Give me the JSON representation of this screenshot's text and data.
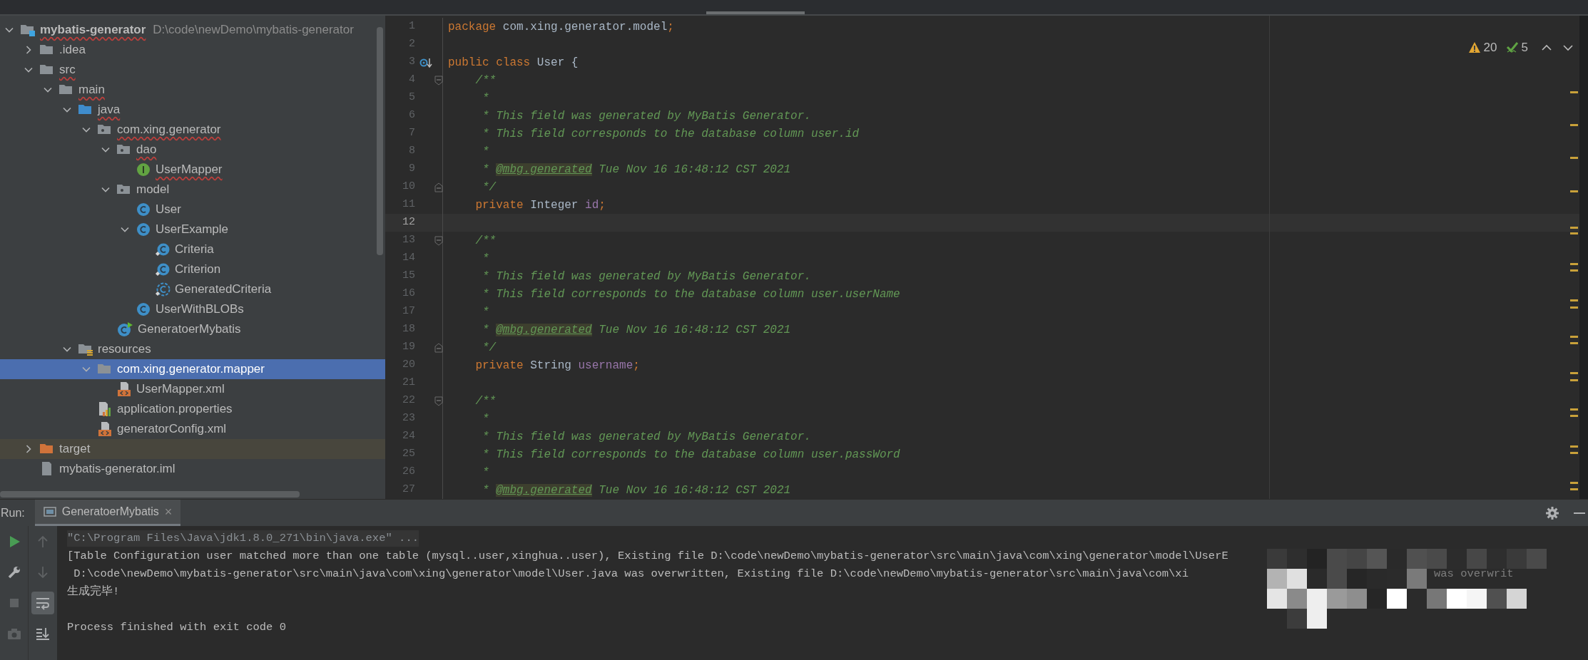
{
  "project_tree": {
    "items": [
      {
        "kind": "module",
        "label": "mybatis-generator",
        "path": "D:\\code\\newDemo\\mybatis-generator",
        "expanded": true,
        "selected": false,
        "error": true,
        "children": [
          {
            "kind": "folder",
            "label": ".idea",
            "expanded": false,
            "selected": false,
            "error": false
          },
          {
            "kind": "folder",
            "label": "src",
            "expanded": true,
            "selected": false,
            "error": true,
            "children": [
              {
                "kind": "folder",
                "label": "main",
                "expanded": true,
                "selected": false,
                "error": true,
                "children": [
                  {
                    "kind": "source-folder",
                    "label": "java",
                    "expanded": true,
                    "selected": false,
                    "error": true,
                    "children": [
                      {
                        "kind": "package",
                        "label": "com.xing.generator",
                        "expanded": true,
                        "selected": false,
                        "error": true,
                        "children": [
                          {
                            "kind": "package",
                            "label": "dao",
                            "expanded": true,
                            "selected": false,
                            "error": true,
                            "children": [
                              {
                                "kind": "interface",
                                "label": "UserMapper",
                                "selected": false,
                                "error": true
                              }
                            ]
                          },
                          {
                            "kind": "package",
                            "label": "model",
                            "expanded": true,
                            "selected": false,
                            "error": false,
                            "children": [
                              {
                                "kind": "class",
                                "label": "User",
                                "selected": false,
                                "error": false
                              },
                              {
                                "kind": "class",
                                "label": "UserExample",
                                "expanded": true,
                                "selected": false,
                                "error": false,
                                "children": [
                                  {
                                    "kind": "inner-class",
                                    "label": "Criteria",
                                    "selected": false,
                                    "error": false
                                  },
                                  {
                                    "kind": "inner-class",
                                    "label": "Criterion",
                                    "selected": false,
                                    "error": false
                                  },
                                  {
                                    "kind": "abstract-inner-class",
                                    "label": "GeneratedCriteria",
                                    "selected": false,
                                    "error": false
                                  }
                                ]
                              },
                              {
                                "kind": "class",
                                "label": "UserWithBLOBs",
                                "selected": false,
                                "error": false
                              }
                            ]
                          },
                          {
                            "kind": "runnable-class",
                            "label": "GeneratoerMybatis",
                            "selected": false,
                            "error": false
                          }
                        ]
                      }
                    ]
                  },
                  {
                    "kind": "resources-folder",
                    "label": "resources",
                    "expanded": true,
                    "selected": false,
                    "error": false,
                    "children": [
                      {
                        "kind": "folder",
                        "label": "com.xing.generator.mapper",
                        "expanded": true,
                        "selected": true,
                        "error": false,
                        "children": [
                          {
                            "kind": "xml",
                            "label": "UserMapper.xml",
                            "selected": false,
                            "error": false
                          }
                        ]
                      },
                      {
                        "kind": "properties",
                        "label": "application.properties",
                        "selected": false,
                        "error": false
                      },
                      {
                        "kind": "xml",
                        "label": "generatorConfig.xml",
                        "selected": false,
                        "error": false
                      }
                    ]
                  }
                ]
              }
            ]
          },
          {
            "kind": "excluded-folder",
            "label": "target",
            "expanded": false,
            "selected": false,
            "error": false,
            "highlighted": true
          },
          {
            "kind": "iml",
            "label": "mybatis-generator.iml",
            "selected": false,
            "error": false
          }
        ]
      }
    ]
  },
  "editor": {
    "problems": {
      "warnings": "20",
      "weak_warnings": "5"
    },
    "lines": [
      {
        "number": "1",
        "tokens": [
          {
            "kind": "keyword",
            "text": "package"
          },
          {
            "kind": "plain",
            "text": " com.xing.generator.model"
          },
          {
            "kind": "keyword",
            "text": ";"
          }
        ]
      },
      {
        "number": "2"
      },
      {
        "number": "3",
        "implemented_marker": true,
        "tokens": [
          {
            "kind": "keyword",
            "text": "public class"
          },
          {
            "kind": "plain",
            "text": " User {"
          }
        ]
      },
      {
        "number": "4",
        "fold_start": true,
        "tokens": [
          {
            "kind": "comment",
            "text": "    /**"
          }
        ]
      },
      {
        "number": "5",
        "tokens": [
          {
            "kind": "comment",
            "text": "     *"
          }
        ]
      },
      {
        "number": "6",
        "tokens": [
          {
            "kind": "comment",
            "text": "     * This field was generated by MyBatis Generator."
          }
        ]
      },
      {
        "number": "7",
        "tokens": [
          {
            "kind": "comment",
            "text": "     * This field corresponds to the database column user.id"
          }
        ]
      },
      {
        "number": "8",
        "tokens": [
          {
            "kind": "comment",
            "text": "     *"
          }
        ]
      },
      {
        "number": "9",
        "tokens": [
          {
            "kind": "comment",
            "text": "     * "
          },
          {
            "kind": "tag",
            "text": "@mbg.generated"
          },
          {
            "kind": "comment",
            "text": " Tue Nov 16 16:48:12 CST 2021"
          }
        ]
      },
      {
        "number": "10",
        "fold_end": true,
        "tokens": [
          {
            "kind": "comment",
            "text": "     */"
          }
        ]
      },
      {
        "number": "11",
        "tokens": [
          {
            "kind": "keyword",
            "text": "    private"
          },
          {
            "kind": "plain",
            "text": " Integer "
          },
          {
            "kind": "field",
            "text": "id"
          },
          {
            "kind": "keyword",
            "text": ";"
          }
        ]
      },
      {
        "number": "12",
        "current": true
      },
      {
        "number": "13",
        "fold_start": true,
        "tokens": [
          {
            "kind": "comment",
            "text": "    /**"
          }
        ]
      },
      {
        "number": "14",
        "tokens": [
          {
            "kind": "comment",
            "text": "     *"
          }
        ]
      },
      {
        "number": "15",
        "tokens": [
          {
            "kind": "comment",
            "text": "     * This field was generated by MyBatis Generator."
          }
        ]
      },
      {
        "number": "16",
        "tokens": [
          {
            "kind": "comment",
            "text": "     * This field corresponds to the database column user.userName"
          }
        ]
      },
      {
        "number": "17",
        "tokens": [
          {
            "kind": "comment",
            "text": "     *"
          }
        ]
      },
      {
        "number": "18",
        "tokens": [
          {
            "kind": "comment",
            "text": "     * "
          },
          {
            "kind": "tag",
            "text": "@mbg.generated"
          },
          {
            "kind": "comment",
            "text": " Tue Nov 16 16:48:12 CST 2021"
          }
        ]
      },
      {
        "number": "19",
        "fold_end": true,
        "tokens": [
          {
            "kind": "comment",
            "text": "     */"
          }
        ]
      },
      {
        "number": "20",
        "tokens": [
          {
            "kind": "keyword",
            "text": "    private"
          },
          {
            "kind": "plain",
            "text": " String "
          },
          {
            "kind": "field",
            "text": "username"
          },
          {
            "kind": "keyword",
            "text": ";"
          }
        ]
      },
      {
        "number": "21"
      },
      {
        "number": "22",
        "fold_start": true,
        "tokens": [
          {
            "kind": "comment",
            "text": "    /**"
          }
        ]
      },
      {
        "number": "23",
        "tokens": [
          {
            "kind": "comment",
            "text": "     *"
          }
        ]
      },
      {
        "number": "24",
        "tokens": [
          {
            "kind": "comment",
            "text": "     * This field was generated by MyBatis Generator."
          }
        ]
      },
      {
        "number": "25",
        "tokens": [
          {
            "kind": "comment",
            "text": "     * This field corresponds to the database column user.passWord"
          }
        ]
      },
      {
        "number": "26",
        "tokens": [
          {
            "kind": "comment",
            "text": "     *"
          }
        ]
      },
      {
        "number": "27",
        "tokens": [
          {
            "kind": "comment",
            "text": "     * "
          },
          {
            "kind": "tag",
            "text": "@mbg.generated"
          },
          {
            "kind": "comment",
            "text": " Tue Nov 16 16:48:12 CST 2021"
          }
        ]
      }
    ]
  },
  "run": {
    "label": "Run:",
    "tabs": [
      {
        "label": "GeneratoerMybatis",
        "close": "×",
        "selected": true
      }
    ],
    "tools_left": [
      {
        "kind": "rerun",
        "disabled": false
      },
      {
        "kind": "wrench",
        "disabled": false
      },
      {
        "kind": "stop",
        "disabled": true
      },
      {
        "kind": "camera",
        "disabled": true
      }
    ],
    "tools_right": [
      {
        "kind": "up",
        "disabled": true,
        "on": false
      },
      {
        "kind": "down",
        "disabled": true,
        "on": false
      },
      {
        "kind": "soft-wrap",
        "disabled": false,
        "on": true
      },
      {
        "kind": "scroll-end",
        "disabled": false,
        "on": false
      }
    ],
    "console": [
      {
        "kind": "command",
        "text": "\"C:\\Program Files\\Java\\jdk1.8.0_271\\bin\\java.exe\" ..."
      },
      {
        "kind": "output",
        "text": "[Table Configuration user matched more than one table (mysql..user,xinghua..user), Existing file D:\\code\\newDemo\\mybatis-generator\\src\\main\\java\\com\\xing\\generator\\model\\UserE"
      },
      {
        "kind": "output",
        "text": " D:\\code\\newDemo\\mybatis-generator\\src\\main\\java\\com\\xing\\generator\\model\\User.java was overwritten, Existing file D:\\code\\newDemo\\mybatis-generator\\src\\main\\java\\com\\xi",
        "fragment": "was overwrit"
      },
      {
        "kind": "output",
        "text": "生成完毕!"
      },
      {
        "kind": "blank"
      },
      {
        "kind": "output",
        "text": "Process finished with exit code 0"
      }
    ]
  }
}
